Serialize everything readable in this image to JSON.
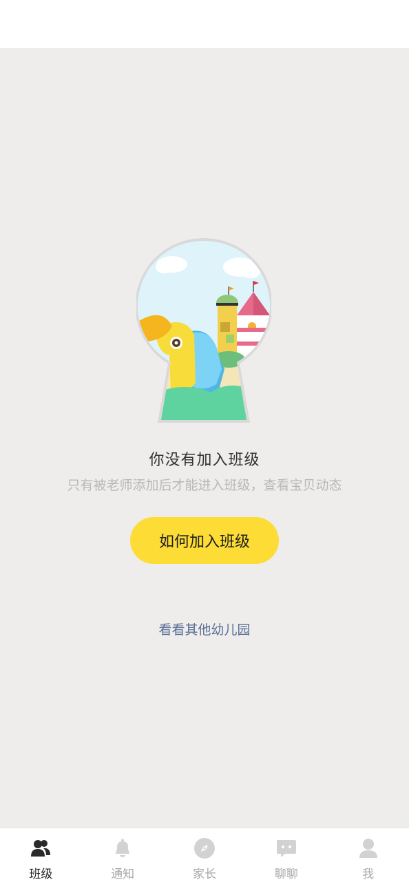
{
  "empty_state": {
    "title": "你没有加入班级",
    "subtitle": "只有被老师添加后才能进入班级，查看宝贝动态",
    "join_button_label": "如何加入班级",
    "other_link_label": "看看其他幼儿园"
  },
  "tabbar": {
    "active_tab": "班级",
    "tabs": [
      {
        "label": "班级",
        "icon": "class-people-icon"
      },
      {
        "label": "通知",
        "icon": "bell-icon"
      },
      {
        "label": "家长",
        "icon": "compass-icon"
      },
      {
        "label": "聊聊",
        "icon": "chat-bubble-icon"
      },
      {
        "label": "我",
        "icon": "person-icon"
      }
    ]
  },
  "colors": {
    "accent": "#fcdc35",
    "background": "#eeedeb",
    "link": "#5a6f96",
    "inactive_tab": "#cfcfcf",
    "active_tab": "#222222"
  }
}
